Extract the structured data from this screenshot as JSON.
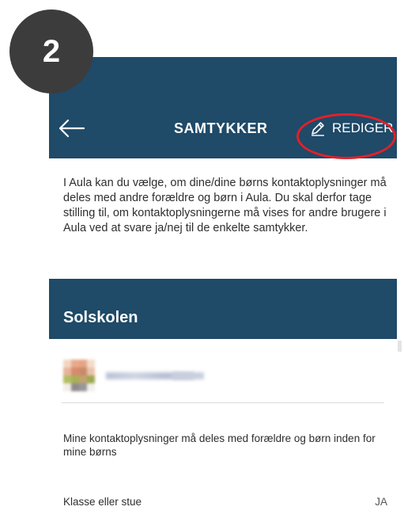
{
  "step_badge": "2",
  "header": {
    "title": "SAMTYKKER",
    "edit_label": "REDIGER"
  },
  "intro_text": "I Aula kan du vælge, om dine/dine børns kontaktoplysninger må deles med andre forældre og børn i Aula. Du skal derfor tage stilling til, om kontaktoplysningerne må vises for andre brugere i Aula ved at svare ja/nej til de enkelte samtykker.",
  "school": {
    "name": "Solskolen"
  },
  "consent": {
    "question": "Mine kontaktoplysninger må deles med forældre og børn inden for mine børns",
    "row_label": "Klasse eller stue",
    "row_value": "JA"
  },
  "colors": {
    "header_bg": "#1f4a68",
    "highlight": "#e3202a",
    "badge_bg": "#3c3c3c"
  },
  "icons": {
    "back": "arrow-left-icon",
    "edit": "pencil-icon"
  }
}
